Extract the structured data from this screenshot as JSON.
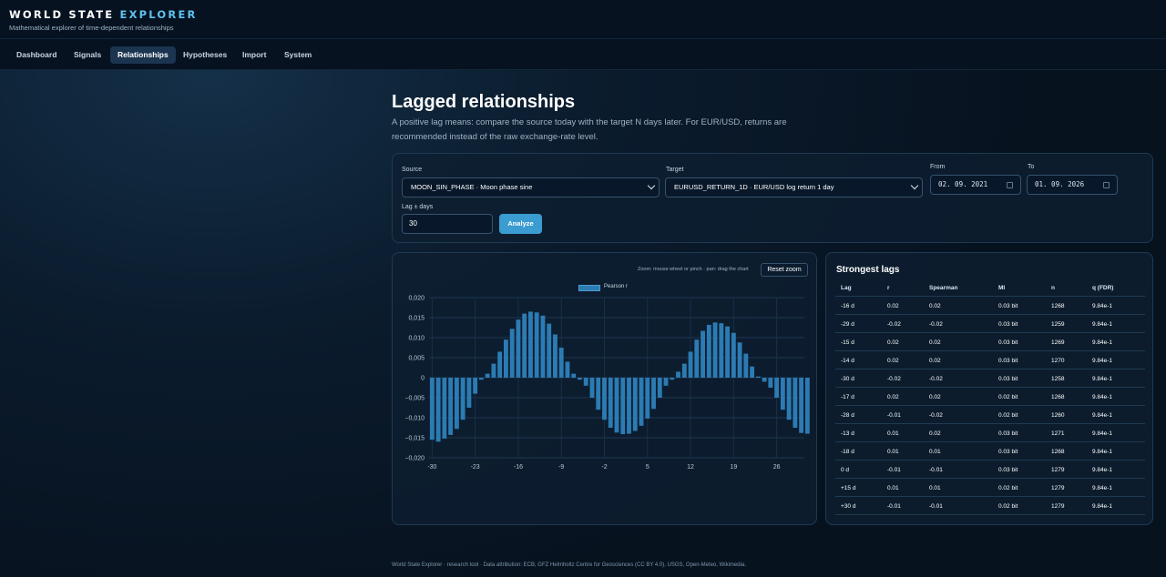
{
  "app": {
    "title_main": "WORLD STATE ",
    "title_accent": "EXPLORER",
    "tagline": "Mathematical explorer of time-dependent relationships"
  },
  "nav": {
    "items": [
      {
        "label": "Dashboard"
      },
      {
        "label": "Signals"
      },
      {
        "label": "Relationships"
      },
      {
        "label": "Hypotheses"
      },
      {
        "label": "Import"
      },
      {
        "label": "System"
      }
    ],
    "active": "Relationships"
  },
  "page": {
    "title": "Lagged relationships",
    "description": "A positive lag means: compare the source today with the target N days later. For EUR/USD, returns are recommended instead of the raw exchange-rate level."
  },
  "form": {
    "source_label": "Source",
    "source_value": "MOON_SIN_PHASE · Moon phase sine",
    "target_label": "Target",
    "target_value": "EURUSD_RETURN_1D · EUR/USD log return 1 day",
    "from_label": "From",
    "from_value": "02. 09. 2021",
    "to_label": "To",
    "to_value": "01. 09. 2026",
    "lag_label": "Lag ± days",
    "lag_value": "30",
    "analyze_label": "Analyze"
  },
  "chart": {
    "hint": "Zoom: mouse wheel or pinch · pan: drag the chart",
    "reset_label": "Reset zoom"
  },
  "chart_data": {
    "type": "bar",
    "x": [
      -30,
      -29,
      -28,
      -27,
      -26,
      -25,
      -24,
      -23,
      -22,
      -21,
      -20,
      -19,
      -18,
      -17,
      -16,
      -15,
      -14,
      -13,
      -12,
      -11,
      -10,
      -9,
      -8,
      -7,
      -6,
      -5,
      -4,
      -3,
      -2,
      -1,
      0,
      1,
      2,
      3,
      4,
      5,
      6,
      7,
      8,
      9,
      10,
      11,
      12,
      13,
      14,
      15,
      16,
      17,
      18,
      19,
      20,
      21,
      22,
      23,
      24,
      25,
      26,
      27,
      28,
      29,
      30
    ],
    "series": [
      {
        "name": "Pearson r",
        "values": [
          -0.0155,
          -0.016,
          -0.0152,
          -0.0143,
          -0.0128,
          -0.0105,
          -0.0075,
          -0.004,
          -0.0005,
          0.001,
          0.0035,
          0.0065,
          0.0095,
          0.0122,
          0.0145,
          0.016,
          0.0165,
          0.0163,
          0.0155,
          0.0135,
          0.0108,
          0.0075,
          0.004,
          0.001,
          -0.0005,
          -0.002,
          -0.005,
          -0.008,
          -0.0105,
          -0.0125,
          -0.0137,
          -0.0141,
          -0.014,
          -0.0133,
          -0.012,
          -0.0102,
          -0.0078,
          -0.005,
          -0.002,
          -0.0005,
          0.0015,
          0.0035,
          0.0065,
          0.0095,
          0.0117,
          0.0132,
          0.0138,
          0.0136,
          0.0128,
          0.0112,
          0.0088,
          0.006,
          0.0028,
          0.0003,
          -0.001,
          -0.0025,
          -0.005,
          -0.008,
          -0.0105,
          -0.0125,
          -0.0138,
          -0.014
        ]
      }
    ],
    "xticks": [
      "-30",
      "-23",
      "-16",
      "-9",
      "-2",
      "5",
      "12",
      "19",
      "26"
    ],
    "yticks": [
      "0,020",
      "0,015",
      "0,010",
      "0,005",
      "0",
      "−0,005",
      "−0,010",
      "−0,015",
      "−0,020"
    ],
    "ylim": [
      -0.02,
      0.02
    ],
    "grid": true,
    "legend": "top-center",
    "color": "#2c7bb3"
  },
  "table": {
    "title": "Strongest lags",
    "headers": [
      "Lag",
      "r",
      "Spearman",
      "MI",
      "n",
      "q (FDR)"
    ],
    "rows": [
      [
        "-16 d",
        "0.02",
        "0.02",
        "0.03 bit",
        "1268",
        "9.84e-1"
      ],
      [
        "-29 d",
        "-0.02",
        "-0.02",
        "0.03 bit",
        "1259",
        "9.84e-1"
      ],
      [
        "-15 d",
        "0.02",
        "0.02",
        "0.03 bit",
        "1269",
        "9.84e-1"
      ],
      [
        "-14 d",
        "0.02",
        "0.02",
        "0.03 bit",
        "1270",
        "9.84e-1"
      ],
      [
        "-30 d",
        "-0.02",
        "-0.02",
        "0.03 bit",
        "1258",
        "9.84e-1"
      ],
      [
        "-17 d",
        "0.02",
        "0.02",
        "0.02 bit",
        "1268",
        "9.84e-1"
      ],
      [
        "-28 d",
        "-0.01",
        "-0.02",
        "0.02 bit",
        "1260",
        "9.84e-1"
      ],
      [
        "-13 d",
        "0.01",
        "0.02",
        "0.03 bit",
        "1271",
        "9.84e-1"
      ],
      [
        "-18 d",
        "0.01",
        "0.01",
        "0.03 bit",
        "1268",
        "9.84e-1"
      ],
      [
        "0 d",
        "-0.01",
        "-0.01",
        "0.03 bit",
        "1279",
        "9.84e-1"
      ],
      [
        "+15 d",
        "0.01",
        "0.01",
        "0.02 bit",
        "1279",
        "9.84e-1"
      ],
      [
        "+30 d",
        "-0.01",
        "-0.01",
        "0.02 bit",
        "1279",
        "9.84e-1"
      ]
    ]
  },
  "footer": {
    "text": "World State Explorer · research tool · Data attribution: ECB, GFZ Helmholtz Centre for Geosciences (CC BY 4.0), USGS, Open-Meteo, Wikimedia."
  }
}
